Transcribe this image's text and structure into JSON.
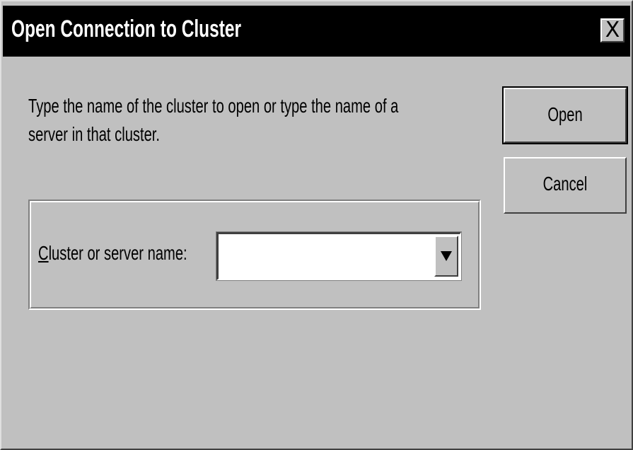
{
  "dialog": {
    "title": "Open Connection to Cluster",
    "close_glyph": "X",
    "instruction_line1": "Type the name of the cluster to open or type the name of a",
    "instruction_line2": "server in that cluster.",
    "field": {
      "label_accel": "C",
      "label_rest": "luster or server name:",
      "value": ""
    },
    "buttons": {
      "open_label": "Open",
      "cancel_label": "Cancel"
    }
  },
  "icons": {
    "close": "close-icon",
    "dropdown": "chevron-down-icon"
  },
  "colors": {
    "face": "#c0c0c0",
    "title_bar": "#000000",
    "title_text": "#ffffff",
    "input_bg": "#ffffff"
  }
}
